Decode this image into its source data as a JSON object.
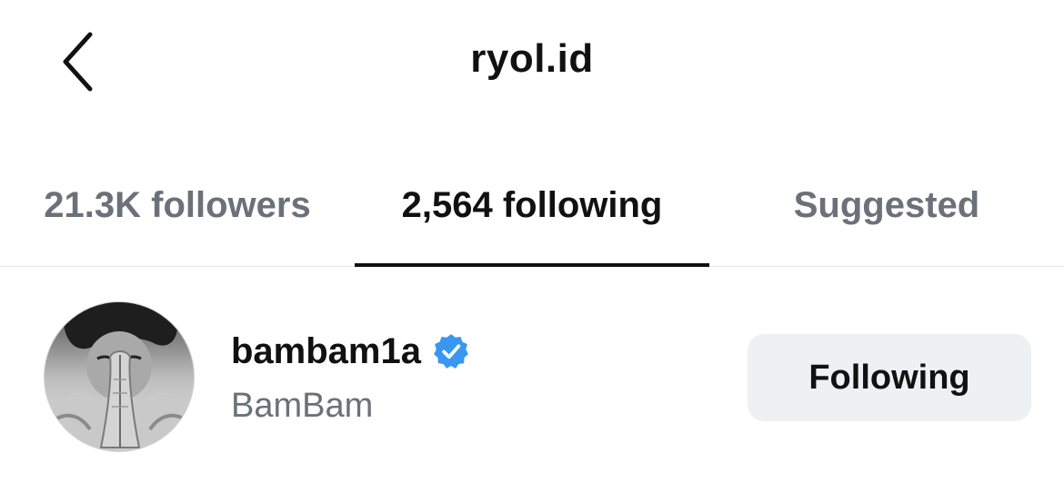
{
  "header": {
    "title": "ryol.id",
    "back_icon": "chevron-left-icon"
  },
  "tabs": [
    {
      "label": "21.3K followers",
      "active": false
    },
    {
      "label": "2,564 following",
      "active": true
    },
    {
      "label": "Suggested",
      "active": false
    }
  ],
  "list": {
    "items": [
      {
        "username": "bambam1a",
        "verified": true,
        "display_name": "BamBam",
        "button_label": "Following",
        "avatar_icon": "profile-photo"
      }
    ]
  },
  "colors": {
    "text_primary": "#111111",
    "text_secondary": "#6b7178",
    "verified_blue": "#3897f0",
    "button_bg": "#eff0f4",
    "divider": "#e4e4e4"
  }
}
